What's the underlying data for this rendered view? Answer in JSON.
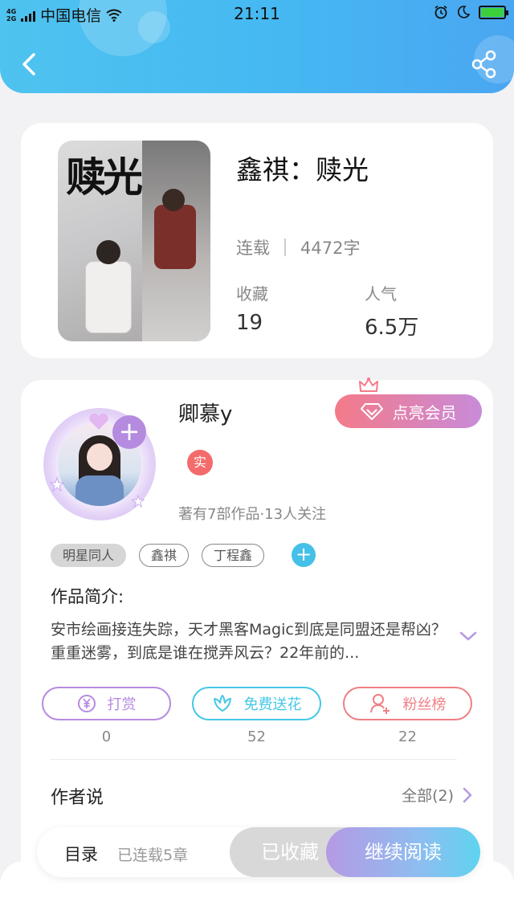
{
  "status_bar": {
    "net_top": "4G",
    "net_bottom": "2G",
    "carrier": "中国电信",
    "time": "21:11"
  },
  "book": {
    "cover_title": "赎光",
    "title": "鑫祺：赎光",
    "status": "连载",
    "word_count": "4472字",
    "favorites_label": "收藏",
    "favorites_value": "19",
    "popularity_label": "人气",
    "popularity_value": "6.5万"
  },
  "author": {
    "name": "卿慕y",
    "vip_label": "点亮会员",
    "real_badge": "实",
    "meta": "著有7部作品·13人关注",
    "add_symbol": "+"
  },
  "tags": [
    "明星同人",
    "鑫祺",
    "丁程鑫"
  ],
  "tag_add": "+",
  "intro": {
    "label": "作品简介:",
    "text": "安市绘画接连失踪，天才黑客Magic到底是同盟还是帮凶？重重迷雾，到底是谁在搅弄风云？22年前的..."
  },
  "actions": [
    {
      "label": "打赏",
      "count": "0",
      "color": "#b68be0",
      "icon": "yen-icon"
    },
    {
      "label": "免费送花",
      "count": "52",
      "color": "#45c8e6",
      "icon": "flower-icon"
    },
    {
      "label": "粉丝榜",
      "count": "22",
      "color": "#f07f85",
      "icon": "fans-icon"
    }
  ],
  "author_says": {
    "label": "作者说",
    "all_label": "全部(2)"
  },
  "bottom_bar": {
    "toc_label": "目录",
    "chapters": "已连载5章",
    "favorited_label": "已收藏",
    "read_label": "继续阅读"
  }
}
